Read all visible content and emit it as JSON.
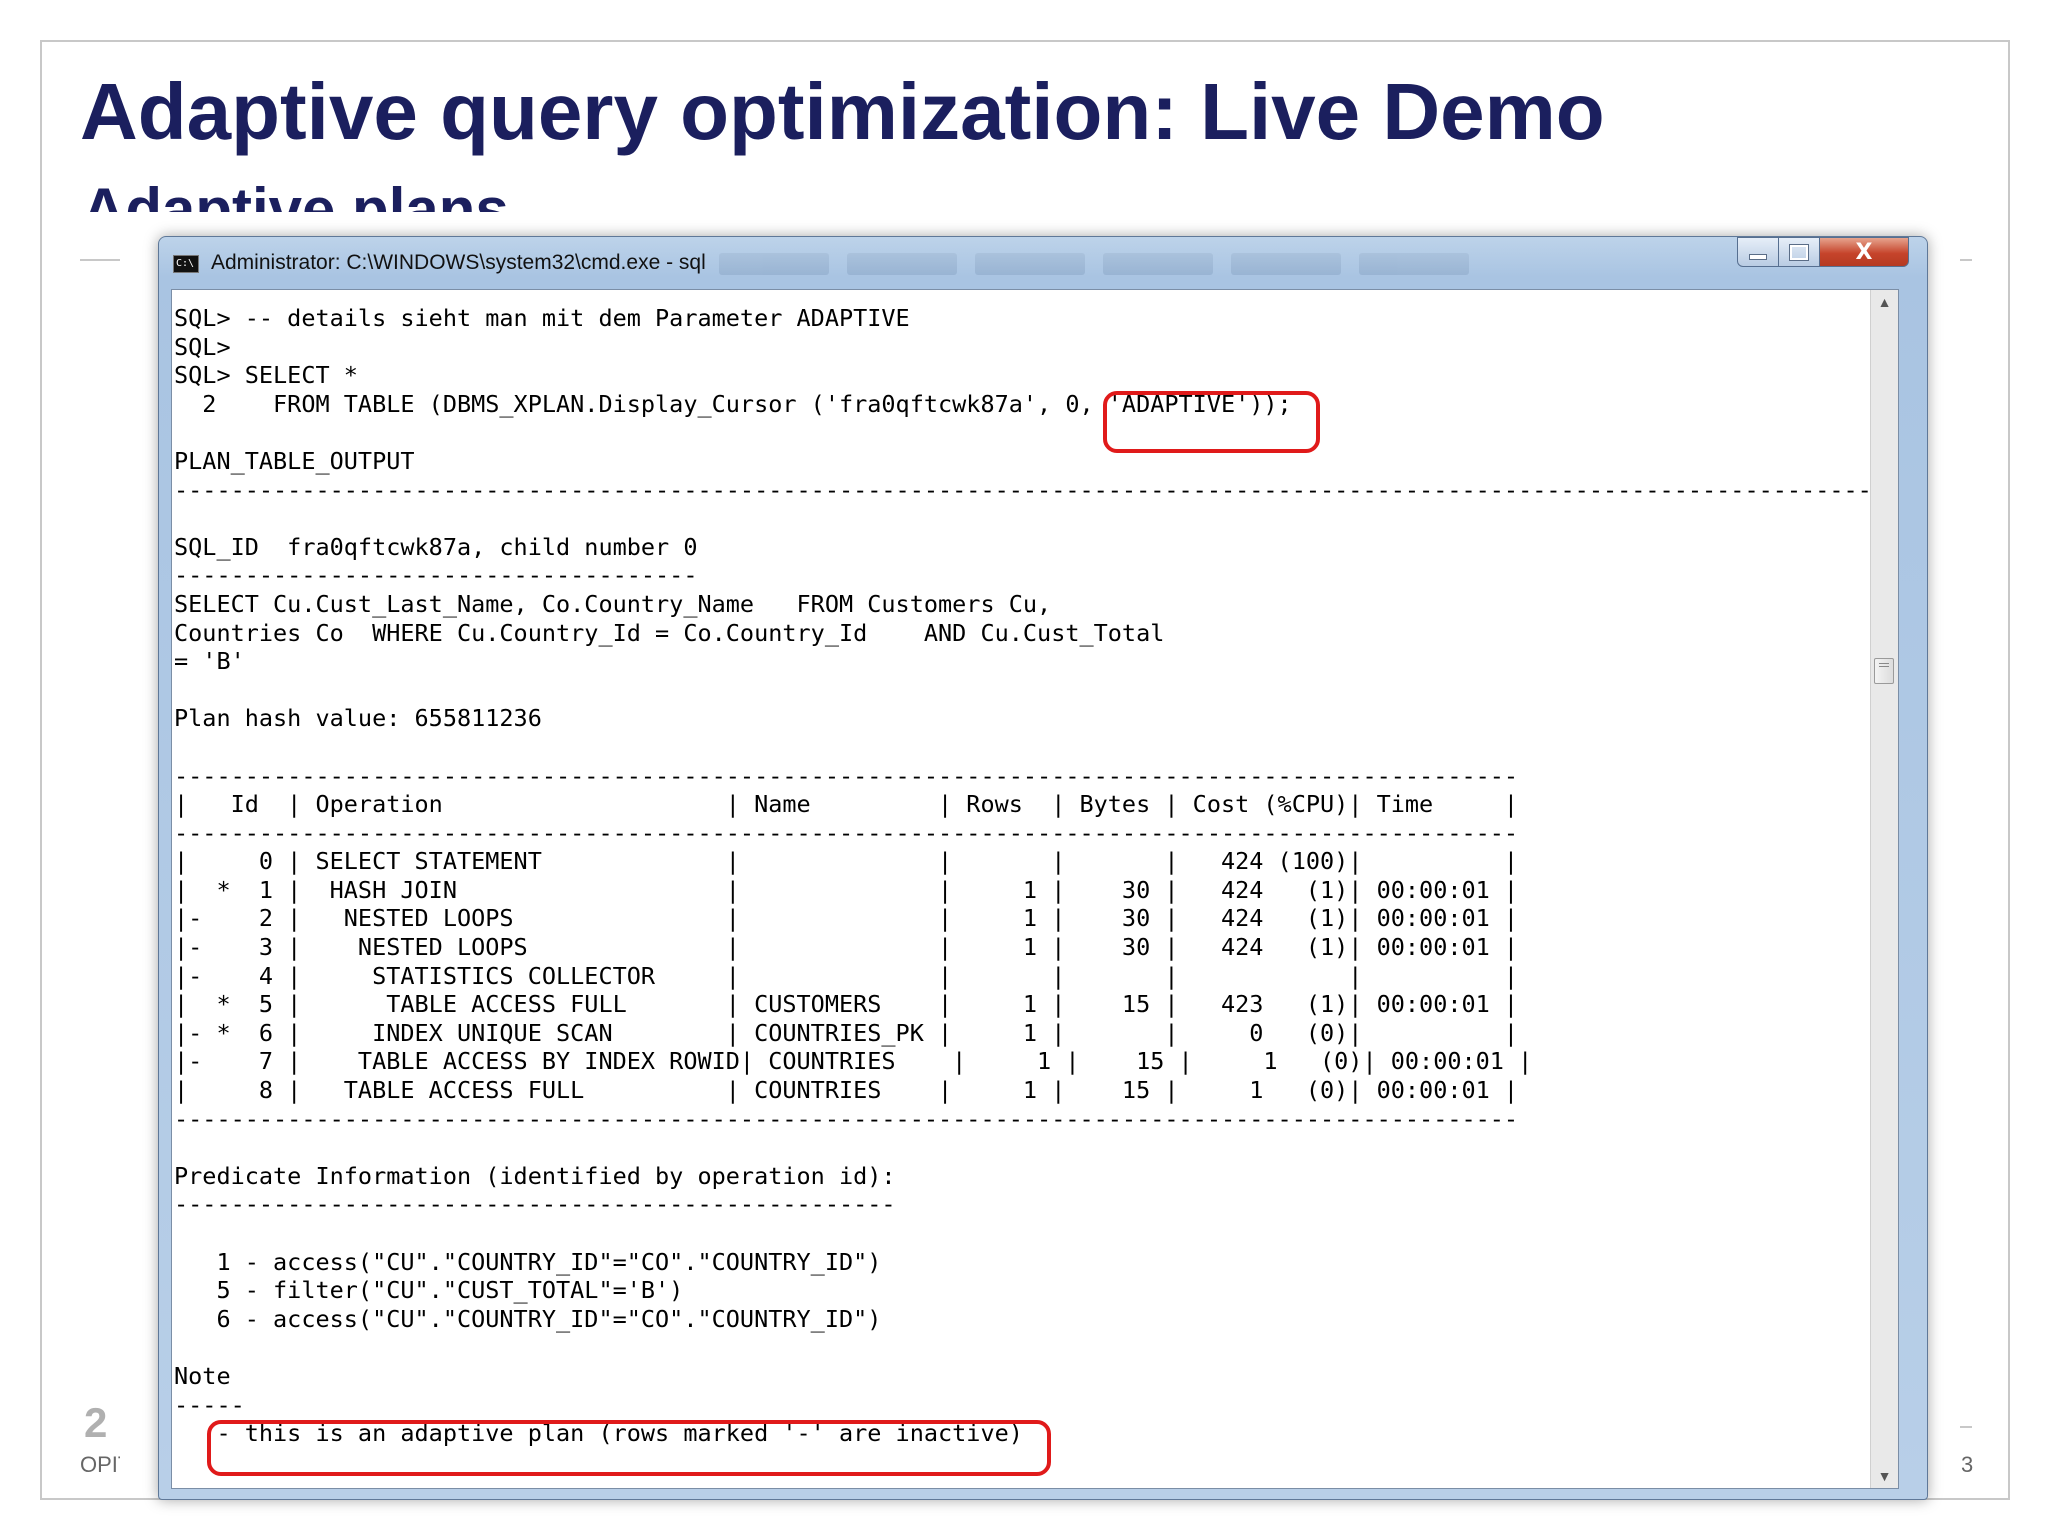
{
  "slide": {
    "title": "Adaptive query optimization: Live Demo",
    "subtitle": "Adaptive plans",
    "footer_logo": "2",
    "footer_text": "OPITZ",
    "page_number": "3"
  },
  "window": {
    "title": "Administrator: C:\\WINDOWS\\system32\\cmd.exe - sql",
    "icon_label": "C:\\",
    "controls": {
      "minimize": "minimize",
      "maximize": "maximize",
      "close": "X"
    }
  },
  "console": {
    "lines": [
      "SQL> -- details sieht man mit dem Parameter ADAPTIVE",
      "SQL>",
      "SQL> SELECT *",
      "  2    FROM TABLE (DBMS_XPLAN.Display_Cursor ('fra0qftcwk87a', 0, 'ADAPTIVE'));",
      "",
      "PLAN_TABLE_OUTPUT",
      "------------------------------------------------------------------------------------------------------------------------",
      "",
      "SQL_ID  fra0qftcwk87a, child number 0",
      "-------------------------------------",
      "SELECT Cu.Cust_Last_Name, Co.Country_Name   FROM Customers Cu,",
      "Countries Co  WHERE Cu.Country_Id = Co.Country_Id    AND Cu.Cust_Total",
      "= 'B'",
      "",
      "Plan hash value: 655811236",
      "",
      "-----------------------------------------------------------------------------------------------",
      "|   Id  | Operation                    | Name         | Rows  | Bytes | Cost (%CPU)| Time     |",
      "-----------------------------------------------------------------------------------------------",
      "|     0 | SELECT STATEMENT             |              |       |       |   424 (100)|          |",
      "|  *  1 |  HASH JOIN                   |              |     1 |    30 |   424   (1)| 00:00:01 |",
      "|-    2 |   NESTED LOOPS               |              |     1 |    30 |   424   (1)| 00:00:01 |",
      "|-    3 |    NESTED LOOPS              |              |     1 |    30 |   424   (1)| 00:00:01 |",
      "|-    4 |     STATISTICS COLLECTOR     |              |       |       |            |          |",
      "|  *  5 |      TABLE ACCESS FULL       | CUSTOMERS    |     1 |    15 |   423   (1)| 00:00:01 |",
      "|- *  6 |     INDEX UNIQUE SCAN        | COUNTRIES_PK |     1 |       |     0   (0)|          |",
      "|-    7 |    TABLE ACCESS BY INDEX ROWID| COUNTRIES    |     1 |    15 |     1   (0)| 00:00:01 |",
      "|     8 |   TABLE ACCESS FULL          | COUNTRIES    |     1 |    15 |     1   (0)| 00:00:01 |",
      "-----------------------------------------------------------------------------------------------",
      "",
      "Predicate Information (identified by operation id):",
      "---------------------------------------------------",
      "",
      "   1 - access(\"CU\".\"COUNTRY_ID\"=\"CO\".\"COUNTRY_ID\")",
      "   5 - filter(\"CU\".\"CUST_TOTAL\"='B')",
      "   6 - access(\"CU\".\"COUNTRY_ID\"=\"CO\".\"COUNTRY_ID\")",
      "",
      "Note",
      "-----",
      "   - this is an adaptive plan (rows marked '-' are inactive)"
    ]
  },
  "colors": {
    "title": "#1b1f5e",
    "highlight": "#e01a1a",
    "console_bg": "#ffffff"
  }
}
